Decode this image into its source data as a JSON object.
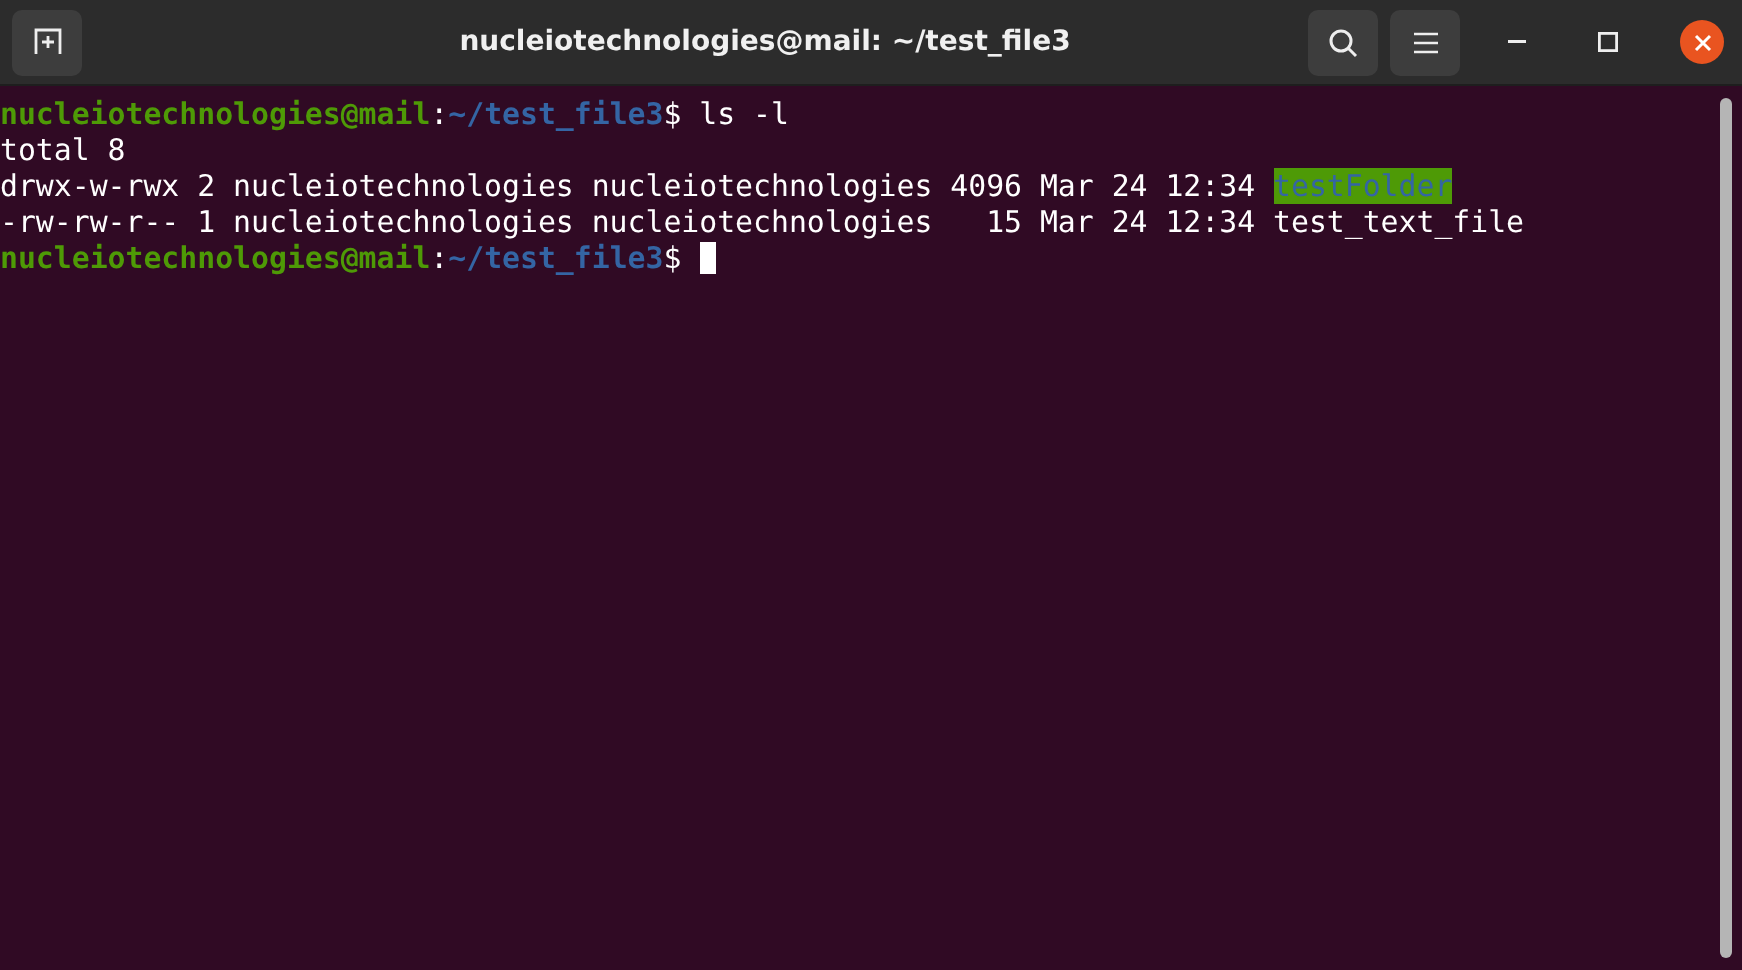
{
  "window": {
    "title": "nucleiotechnologies@mail: ~/test_file3"
  },
  "terminal": {
    "lines": [
      {
        "cursor": false,
        "segments": [
          {
            "kind": "user",
            "text": "nucleiotechnologies@mail"
          },
          {
            "kind": "plain",
            "text": ":"
          },
          {
            "kind": "path",
            "text": "~/test_file3"
          },
          {
            "kind": "plain",
            "text": "$ ls -l"
          }
        ]
      },
      {
        "cursor": false,
        "segments": [
          {
            "kind": "plain",
            "text": "total 8"
          }
        ]
      },
      {
        "cursor": false,
        "segments": [
          {
            "kind": "plain",
            "text": "drwx-w-rwx 2 nucleiotechnologies nucleiotechnologies 4096 Mar 24 12:34 "
          },
          {
            "kind": "dir",
            "text": "testFolder"
          }
        ]
      },
      {
        "cursor": false,
        "segments": [
          {
            "kind": "plain",
            "text": "-rw-rw-r-- 1 nucleiotechnologies nucleiotechnologies   15 Mar 24 12:34 test_text_file"
          }
        ]
      },
      {
        "cursor": true,
        "segments": [
          {
            "kind": "user",
            "text": "nucleiotechnologies@mail"
          },
          {
            "kind": "plain",
            "text": ":"
          },
          {
            "kind": "path",
            "text": "~/test_file3"
          },
          {
            "kind": "plain",
            "text": "$ "
          }
        ]
      }
    ]
  }
}
